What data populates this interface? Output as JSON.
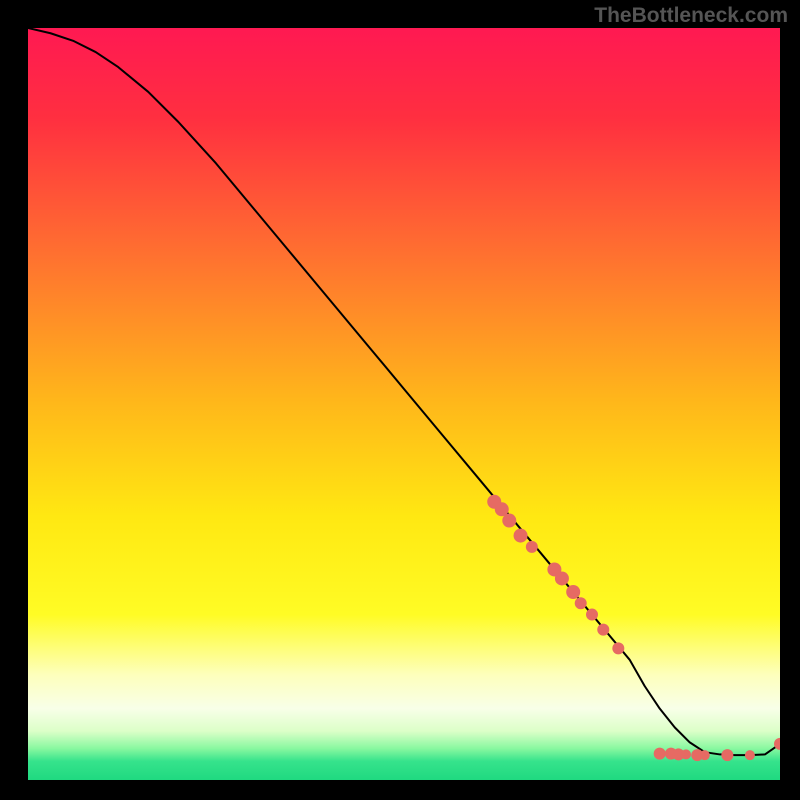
{
  "attribution": "TheBottleneck.com",
  "chart_data": {
    "type": "line",
    "title": "",
    "xlabel": "",
    "ylabel": "",
    "xlim": [
      0,
      100
    ],
    "ylim": [
      0,
      100
    ],
    "background_gradient": {
      "stops": [
        {
          "offset": 0,
          "color": "#ff1952"
        },
        {
          "offset": 0.12,
          "color": "#ff2f40"
        },
        {
          "offset": 0.3,
          "color": "#ff7030"
        },
        {
          "offset": 0.5,
          "color": "#ffb81a"
        },
        {
          "offset": 0.65,
          "color": "#ffe812"
        },
        {
          "offset": 0.78,
          "color": "#fffc25"
        },
        {
          "offset": 0.86,
          "color": "#fdffbc"
        },
        {
          "offset": 0.905,
          "color": "#f8ffe8"
        },
        {
          "offset": 0.935,
          "color": "#dcffc8"
        },
        {
          "offset": 0.958,
          "color": "#89f8a0"
        },
        {
          "offset": 0.975,
          "color": "#36e38c"
        },
        {
          "offset": 1.0,
          "color": "#1fd980"
        }
      ]
    },
    "curve": {
      "color": "#000000",
      "width": 2,
      "x": [
        0,
        3,
        6,
        9,
        12,
        16,
        20,
        25,
        30,
        35,
        40,
        45,
        50,
        55,
        60,
        65,
        70,
        75,
        80,
        82,
        84,
        86,
        88,
        90,
        92,
        94,
        96,
        98,
        100
      ],
      "y": [
        100,
        99.3,
        98.3,
        96.8,
        94.8,
        91.5,
        87.5,
        82,
        76,
        70,
        64,
        58,
        52,
        46,
        40,
        34,
        28,
        22,
        16,
        12.5,
        9.5,
        7,
        5,
        3.7,
        3.4,
        3.3,
        3.3,
        3.4,
        4.8
      ]
    },
    "markers": {
      "color": "#e66a63",
      "radius_default": 6,
      "points": [
        {
          "x": 62,
          "y": 37,
          "r": 7
        },
        {
          "x": 63,
          "y": 36,
          "r": 7
        },
        {
          "x": 64,
          "y": 34.5,
          "r": 7
        },
        {
          "x": 65.5,
          "y": 32.5,
          "r": 7
        },
        {
          "x": 67,
          "y": 31,
          "r": 6
        },
        {
          "x": 70,
          "y": 28,
          "r": 7
        },
        {
          "x": 71,
          "y": 26.8,
          "r": 7
        },
        {
          "x": 72.5,
          "y": 25,
          "r": 7
        },
        {
          "x": 73.5,
          "y": 23.5,
          "r": 6
        },
        {
          "x": 75,
          "y": 22,
          "r": 6
        },
        {
          "x": 76.5,
          "y": 20,
          "r": 6
        },
        {
          "x": 78.5,
          "y": 17.5,
          "r": 6
        },
        {
          "x": 84,
          "y": 3.5,
          "r": 6
        },
        {
          "x": 85.5,
          "y": 3.5,
          "r": 6
        },
        {
          "x": 86.5,
          "y": 3.4,
          "r": 6
        },
        {
          "x": 87.5,
          "y": 3.4,
          "r": 5
        },
        {
          "x": 89,
          "y": 3.3,
          "r": 6
        },
        {
          "x": 90,
          "y": 3.3,
          "r": 5
        },
        {
          "x": 93,
          "y": 3.3,
          "r": 6
        },
        {
          "x": 96,
          "y": 3.3,
          "r": 5
        },
        {
          "x": 100,
          "y": 4.8,
          "r": 6
        }
      ]
    }
  }
}
